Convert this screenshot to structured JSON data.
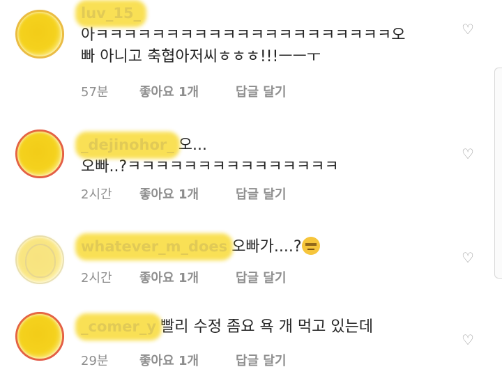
{
  "comments": [
    {
      "username": "luv_15_",
      "lines": [
        "아ㅋㅋㅋㅋㅋㅋㅋㅋㅋㅋㅋㅋㅋㅋㅋㅋㅋㅋㅋㅋㅋ오",
        "빠 아니고 축협아저씨ㅎㅎㅎ!!!ㅡㅡㅜ"
      ],
      "time": "57분",
      "likes": "좋아요 1개",
      "reply": "답글 달기"
    },
    {
      "username": "_dejinohor_",
      "lines": [
        "오...",
        "오빠..?ㅋㅋㅋㅋㅋㅋㅋㅋㅋㅋㅋㅋㅋㅋㅋ"
      ],
      "time": "2시간",
      "likes": "좋아요 1개",
      "reply": "답글 달기"
    },
    {
      "username": "whatever_m_does",
      "lines": [
        "오빠가....?"
      ],
      "emoji": "expressionless-face",
      "time": "2시간",
      "likes": "좋아요 1개",
      "reply": "답글 달기"
    },
    {
      "username": "_comer_y",
      "lines": [
        "빨리 수정 좀요 욕 개 먹고 있는데"
      ],
      "time": "29분",
      "likes": "좋아요 1개",
      "reply": "답글 달기"
    }
  ],
  "icons": {
    "like": "heart-outline-icon"
  },
  "colors": {
    "username_redaction": "#f7d51b",
    "meta_text": "#8e8e8e",
    "story_ring": "#e0494a"
  }
}
